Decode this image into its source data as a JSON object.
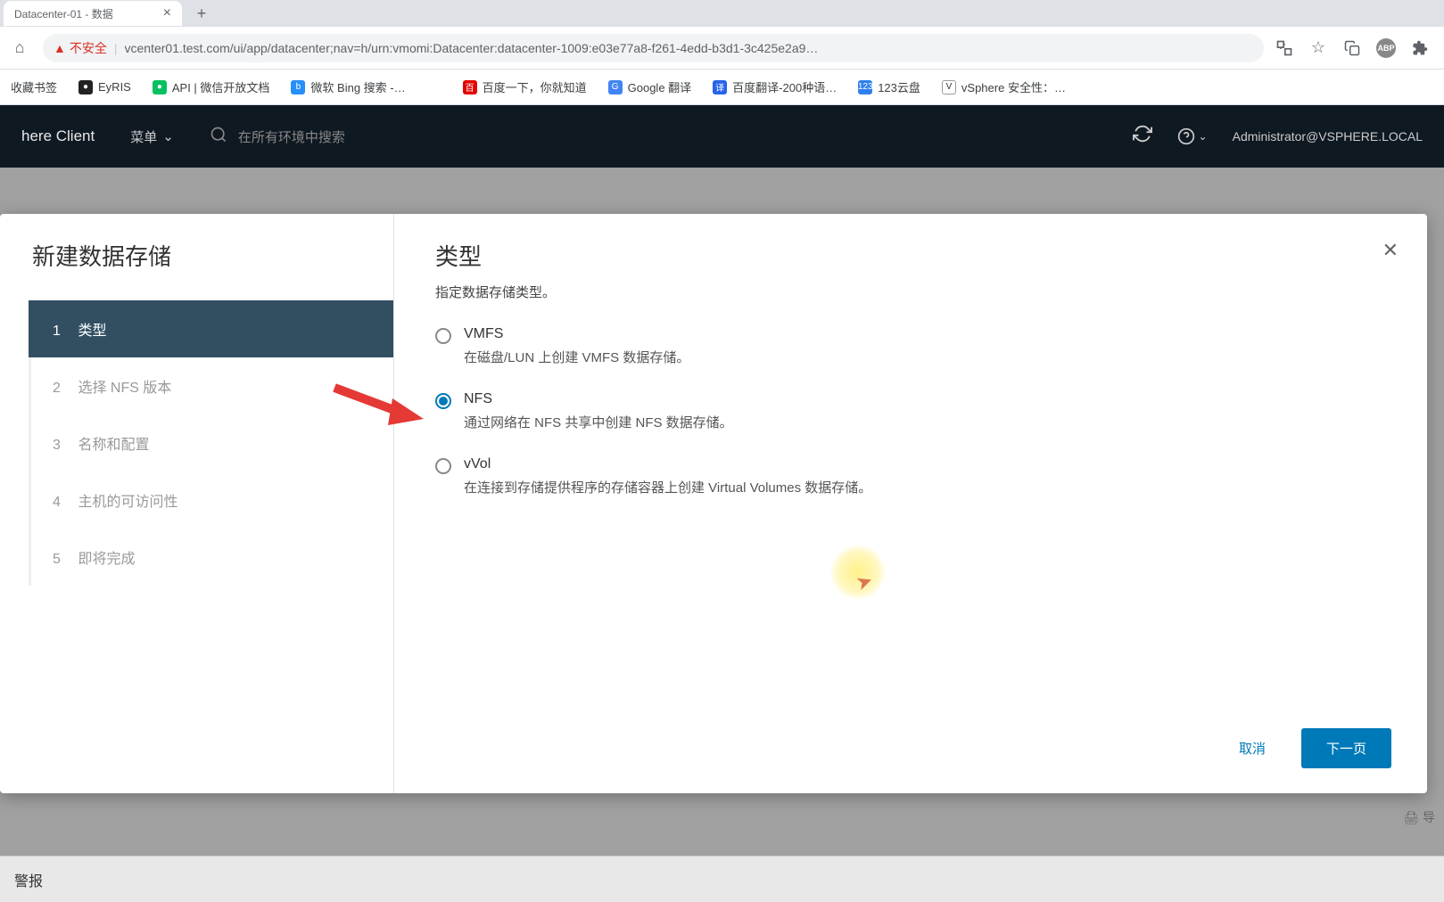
{
  "browser": {
    "tab_title": "Datacenter-01 - 数据",
    "insecure_label": "不安全",
    "url": "vcenter01.test.com/ui/app/datacenter;nav=h/urn:vmomi:Datacenter:datacenter-1009:e03e77a8-f261-4edd-b3d1-3c425e2a9…",
    "bookmarks_label": "收藏书签",
    "bookmarks": [
      {
        "label": "EyRIS",
        "color": "#222"
      },
      {
        "label": "API | 微信开放文档",
        "color": "#07c160"
      },
      {
        "label": "微软 Bing 搜索 -…",
        "color": "#258ffa"
      },
      {
        "label": "百度一下，你就知道",
        "color": "#e53935"
      },
      {
        "label": "Google 翻译",
        "color": "#4285f4"
      },
      {
        "label": "百度翻译-200种语…",
        "color": "#2563eb"
      },
      {
        "label": "123云盘",
        "color": "#2f80ed"
      },
      {
        "label": "vSphere 安全性：…",
        "color": "#333"
      }
    ],
    "abp_label": "ABP"
  },
  "vsphere": {
    "logo": "here Client",
    "menu_label": "菜单",
    "search_placeholder": "在所有环境中搜索",
    "user_label": "Administrator@VSPHERE.LOCAL"
  },
  "dialog": {
    "title": "新建数据存储",
    "steps": [
      {
        "num": "1",
        "label": "类型"
      },
      {
        "num": "2",
        "label": "选择 NFS 版本"
      },
      {
        "num": "3",
        "label": "名称和配置"
      },
      {
        "num": "4",
        "label": "主机的可访问性"
      },
      {
        "num": "5",
        "label": "即将完成"
      }
    ],
    "content_title": "类型",
    "content_subtitle": "指定数据存储类型。",
    "options": [
      {
        "label": "VMFS",
        "desc": "在磁盘/LUN 上创建 VMFS 数据存储。",
        "selected": false
      },
      {
        "label": "NFS",
        "desc": "通过网络在 NFS 共享中创建 NFS 数据存储。",
        "selected": true
      },
      {
        "label": "vVol",
        "desc": "在连接到存储提供程序的存储容器上创建 Virtual Volumes 数据存储。",
        "selected": false
      }
    ],
    "cancel_label": "取消",
    "next_label": "下一页"
  },
  "footer": {
    "export_label": "导",
    "alarm_label": "警报"
  }
}
